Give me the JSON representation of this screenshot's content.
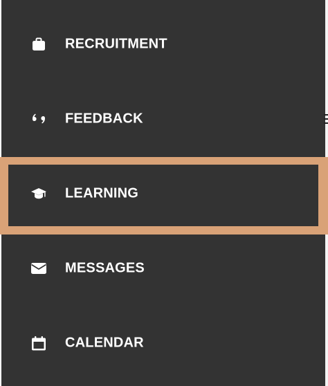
{
  "menu": {
    "items": [
      {
        "label": "RECRUITMENT",
        "icon": "briefcase-icon"
      },
      {
        "label": "FEEDBACK",
        "icon": "quote-icon"
      },
      {
        "label": "LEARNING",
        "icon": "graduation-cap-icon",
        "active": true
      },
      {
        "label": "MESSAGES",
        "icon": "envelope-icon"
      },
      {
        "label": "CALENDAR",
        "icon": "calendar-icon"
      }
    ]
  },
  "colors": {
    "panel_bg": "#333333",
    "text": "#ffffff",
    "highlight": "#d9a277"
  }
}
